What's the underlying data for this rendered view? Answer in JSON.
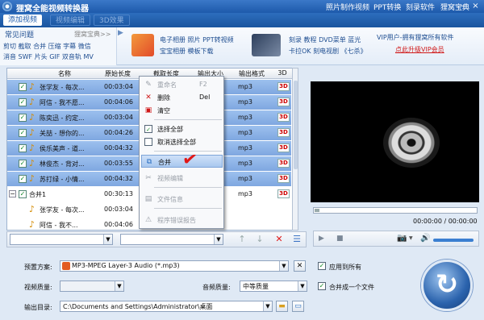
{
  "app": {
    "title": "狸窝全能视频转换器",
    "menus": [
      "照片制作视频",
      "PPT转换",
      "刻录软件",
      "狸窝宝典"
    ]
  },
  "tabs": [
    {
      "label": "添加视频",
      "state": "active"
    },
    {
      "label": "视频编辑",
      "state": "disabled"
    },
    {
      "label": "3D效果",
      "state": "disabled"
    }
  ],
  "banner": {
    "faq_header": "常见问题",
    "faq_link": "狸窝宝典>>",
    "faq_line1": "剪切 截取 合并 压缩 字幕 微信",
    "faq_line2": "消音 SWF 片头 GIF 双音轨 MV",
    "ad1_line1": "电子相册  照片  PPT转视频",
    "ad1_line2": "宝宝相册  模板下载",
    "ad2_line1": "刻录  教程  DVD菜单  蓝光",
    "ad2_line2": "卡拉OK  刻电视剧  《七杀》",
    "vip_line1": "VIP用户-拥有狸窝所有软件",
    "vip_line2": "点此升级VIP会员"
  },
  "list": {
    "columns": [
      "名称",
      "原始长度",
      "截取长度",
      "输出大小",
      "输出格式",
      "3D"
    ],
    "rows": [
      {
        "name": "张学友 - 每次...",
        "duration": "00:03:04",
        "format": "mp3",
        "selected": true,
        "checked": true
      },
      {
        "name": "阿信 - 我不愿...",
        "duration": "00:04:06",
        "format": "mp3",
        "selected": true,
        "checked": true
      },
      {
        "name": "陈奕迅 - 约定...",
        "duration": "00:03:04",
        "format": "mp3",
        "selected": true,
        "checked": true
      },
      {
        "name": "关喆 - 想你的...",
        "duration": "00:04:26",
        "format": "mp3",
        "selected": true,
        "checked": true
      },
      {
        "name": "侯乐美声 - 道...",
        "duration": "00:04:32",
        "format": "mp3",
        "selected": true,
        "checked": true
      },
      {
        "name": "林俊杰 - 背对...",
        "duration": "00:03:55",
        "format": "mp3",
        "selected": true,
        "checked": true
      },
      {
        "name": "苏打绿 - 小情...",
        "duration": "00:04:32",
        "format": "mp3",
        "selected": true,
        "checked": true
      },
      {
        "name": "合并1",
        "duration": "00:30:13",
        "format": "mp3",
        "selected": false,
        "checked": true,
        "group": true
      },
      {
        "name": "张学友 - 每次...",
        "duration": "00:03:04",
        "format": "",
        "selected": false,
        "checked": false,
        "child": true
      },
      {
        "name": "阿信 - 我不...",
        "duration": "00:04:06",
        "format": "",
        "selected": false,
        "checked": false,
        "child": true
      }
    ],
    "badge_3d": "3D"
  },
  "context_menu": {
    "items": [
      {
        "label": "重命名",
        "shortcut": "F2",
        "disabled": true,
        "icon": "rename-icon"
      },
      {
        "label": "删除",
        "shortcut": "Del",
        "disabled": false,
        "icon": "delete-icon"
      },
      {
        "label": "清空",
        "shortcut": "",
        "disabled": false,
        "icon": "clear-icon"
      },
      {
        "label": "选择全部",
        "shortcut": "",
        "disabled": false,
        "icon": "check-icon"
      },
      {
        "label": "取消选择全部",
        "shortcut": "",
        "disabled": false,
        "icon": "uncheck-icon"
      },
      {
        "label": "合并",
        "shortcut": "",
        "disabled": false,
        "icon": "merge-icon",
        "highlighted": true
      },
      {
        "label": "视频编辑",
        "shortcut": "",
        "disabled": true,
        "icon": "scissors-icon"
      },
      {
        "label": "文件信息",
        "shortcut": "",
        "disabled": true,
        "icon": "info-icon"
      },
      {
        "label": "程序错误报告",
        "shortcut": "",
        "disabled": true,
        "icon": "warning-icon"
      }
    ]
  },
  "player": {
    "time": "00:00:00 / 00:00:00"
  },
  "settings": {
    "preset_label": "预置方案:",
    "preset_value": "MP3-MPEG Layer-3 Audio (*.mp3)",
    "apply_all_label": "应用到所有",
    "video_quality_label": "视频质量:",
    "video_quality_value": "",
    "audio_quality_label": "音频质量:",
    "audio_quality_value": "中等质量",
    "merge_label": "合并成一个文件",
    "output_label": "输出目录:",
    "output_value": "C:\\Documents and Settings\\Administrator\\桌面"
  },
  "colors": {
    "accent": "#1d5aab",
    "selection": "#8fb3e6",
    "danger": "#e01818"
  }
}
